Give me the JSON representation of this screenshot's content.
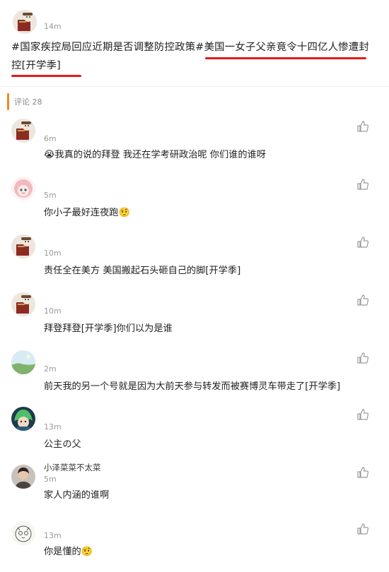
{
  "post": {
    "avatar": "red-book-avatar",
    "time": "14m",
    "text_prefix": "#国家疾控局回应近期是否调整防控政策#",
    "text_underlined": "美国一女子父亲竟令十四亿人惨遭封控",
    "text_suffix": "[开学季]",
    "underline_color": "#e41a1a"
  },
  "comment_section": {
    "count_label": "评论 28",
    "accent_color": "#f08a24"
  },
  "comments": [
    {
      "avatar": "red-book-avatar",
      "name": "",
      "time": "6m",
      "text": "😭我真的说的拜登 我还在学考研政治呢 你们谁的谁呀",
      "like_icon": "thumb-up-icon"
    },
    {
      "avatar": "pink-hair-anime-avatar",
      "name": "",
      "time": "5m",
      "text": "你小子最好连夜跑🤨",
      "like_icon": "thumb-up-icon"
    },
    {
      "avatar": "red-book-avatar",
      "name": "",
      "time": "10m",
      "text": "责任全在美方 美国搬起石头砸自己的脚[开学季]",
      "like_icon": "thumb-up-icon"
    },
    {
      "avatar": "red-book-avatar",
      "name": "",
      "time": "10m",
      "text": "拜登拜登[开学季]你们以为是谁",
      "like_icon": "thumb-up-icon"
    },
    {
      "avatar": "landscape-avatar",
      "name": "",
      "time": "2m",
      "text": "前天我的另一个号就是因为大前天参与转发而被赛博灵车带走了[开学季]",
      "like_icon": "thumb-up-icon"
    },
    {
      "avatar": "green-hair-anime-avatar",
      "name": "",
      "time": "13m",
      "text": "公主の父",
      "like_icon": "thumb-up-icon"
    },
    {
      "avatar": "person-photo-avatar",
      "name": "小泽菜菜不太菜",
      "time": "5m",
      "text": "家人内涵的谁啊",
      "like_icon": "thumb-up-icon"
    },
    {
      "avatar": "sketch-cat-avatar",
      "name": "",
      "time": "13m",
      "text": "你是懂的🤨",
      "like_icon": "thumb-up-icon"
    }
  ]
}
